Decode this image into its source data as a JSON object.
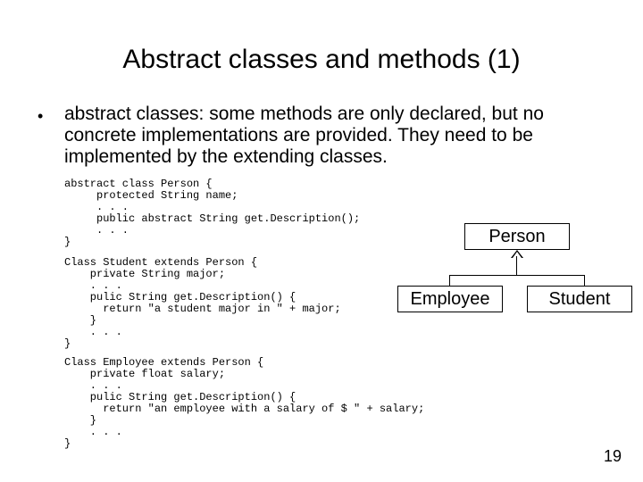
{
  "title": "Abstract classes and methods (1)",
  "bullet": {
    "marker": "•",
    "text": "abstract classes: some methods are only declared, but no concrete implementations are provided. They need to be implemented by the extending classes."
  },
  "code": {
    "person": "abstract class Person {\n     protected String name;\n     . . .\n     public abstract String get.Description();\n     . . .\n}",
    "student": "Class Student extends Person {\n    private String major;\n    . . .\n    pulic String get.Description() {\n      return \"a student major in \" + major;\n    }\n    . . .\n}",
    "employee": "Class Employee extends Person {\n    private float salary;\n    . . .\n    pulic String get.Description() {\n      return \"an employee with a salary of $ \" + salary;\n    }\n    . . .\n}"
  },
  "diagram": {
    "person": "Person",
    "employee": "Employee",
    "student": "Student"
  },
  "page_number": "19"
}
